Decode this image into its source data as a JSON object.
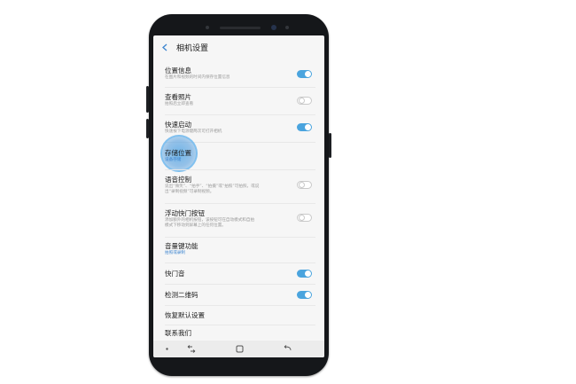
{
  "header": {
    "title": "相机设置"
  },
  "settings": [
    {
      "title": "位置信息",
      "subtitle": "在图片和视频的时间内保存位置信息",
      "toggle": "on"
    },
    {
      "title": "查看照片",
      "subtitle": "拍照后立即查看",
      "toggle": "off"
    },
    {
      "title": "快速启动",
      "subtitle": "快速按下电源键两次可打开相机",
      "toggle": "on"
    },
    {
      "title": "存储位置",
      "subtitle": "设备存储"
    },
    {
      "title": "语音控制",
      "subtitle_line1": "说出“微笑”、“拍手”、“拍摄”或“拍照”可拍照，或说",
      "subtitle_line2": "出“录制视频”可录制视频。",
      "toggle": "off"
    },
    {
      "title": "浮动快门按钮",
      "subtitle_line1": "添加额外的相机按钮，该按钮可在自动模式和自拍",
      "subtitle_line2": "模式下移动到屏幕上的任何位置。",
      "toggle": "off"
    },
    {
      "title": "音量键功能",
      "subtitle": "拍照或录制",
      "subtitle_blue": true
    },
    {
      "title": "快门音",
      "toggle": "on"
    },
    {
      "title": "检测二维码",
      "toggle": "on"
    },
    {
      "title": "恢复默认设置"
    },
    {
      "title": "联系我们"
    }
  ],
  "colors": {
    "toggle_on": "#4aa4de",
    "accent_blue": "#3f86d0"
  },
  "icons": {
    "back": "chevron-left-icon",
    "recent": "recent-apps-icon",
    "home": "home-icon",
    "back_nav": "back-arrow-icon"
  }
}
